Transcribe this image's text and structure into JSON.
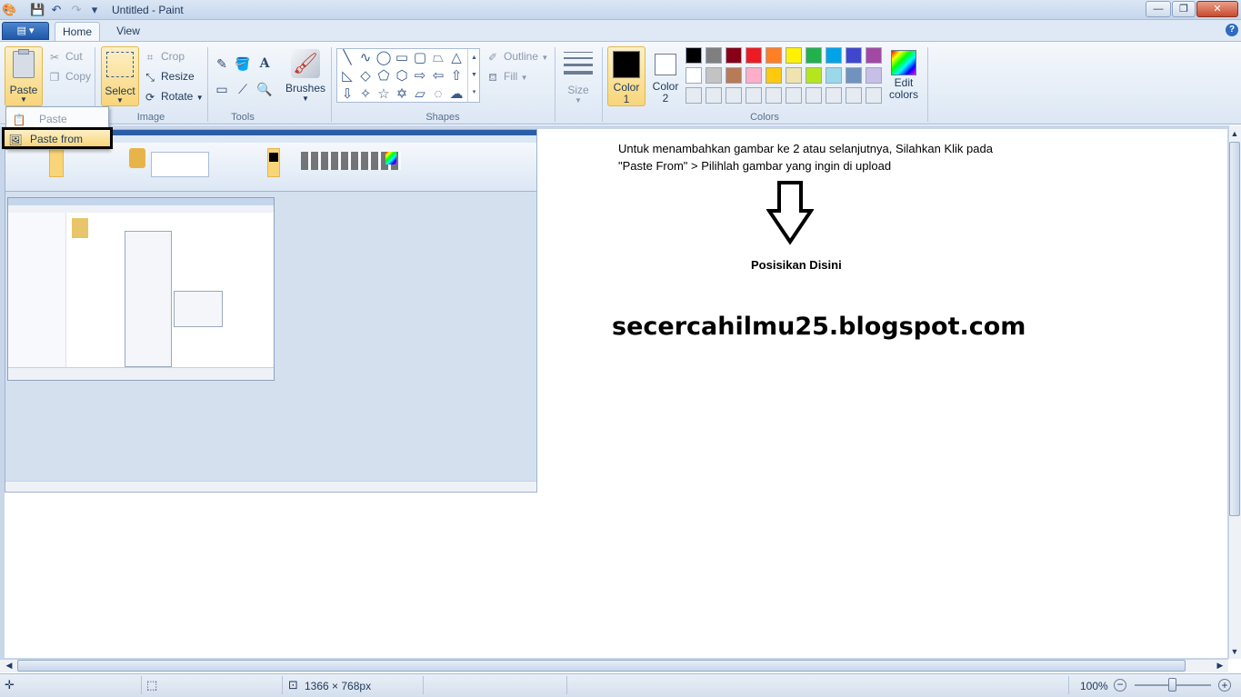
{
  "window": {
    "title": "Untitled - Paint",
    "minimize_glyph": "—",
    "maximize_glyph": "❐",
    "close_glyph": "✕"
  },
  "quick_access": {
    "save_glyph": "💾",
    "undo_glyph": "↶",
    "redo_glyph": "↷",
    "customize_glyph": "▾"
  },
  "tabs": {
    "app_menu_glyph": "▤ ▾",
    "home": "Home",
    "view": "View",
    "help_glyph": "?"
  },
  "clipboard": {
    "paste": "Paste",
    "cut": "Cut",
    "copy": "Copy"
  },
  "image_group": {
    "label": "Image",
    "select": "Select",
    "crop": "Crop",
    "resize": "Resize",
    "rotate": "Rotate"
  },
  "tools_group": {
    "label": "Tools",
    "brushes": "Brushes"
  },
  "shapes_group": {
    "label": "Shapes",
    "outline": "Outline",
    "fill": "Fill"
  },
  "size_group": {
    "size": "Size"
  },
  "colors_group": {
    "label": "Colors",
    "color1_line1": "Color",
    "color1_line2": "1",
    "color2_line1": "Color",
    "color2_line2": "2",
    "edit_line1": "Edit",
    "edit_line2": "colors",
    "color1_value": "#000000",
    "color2_value": "#ffffff",
    "palette_row1": [
      "#000000",
      "#7f7f7f",
      "#880015",
      "#ed1c24",
      "#ff7f27",
      "#fff200",
      "#22b14c",
      "#00a2e8",
      "#3f48cc",
      "#a349a4"
    ],
    "palette_row2": [
      "#ffffff",
      "#c3c3c3",
      "#b97a57",
      "#ffaec9",
      "#ffc90e",
      "#efe4b0",
      "#b5e61d",
      "#99d9ea",
      "#7092be",
      "#c8bfe7"
    ],
    "palette_row3": [
      "#e6ebf2",
      "#e6ebf2",
      "#e6ebf2",
      "#e6ebf2",
      "#e6ebf2",
      "#e6ebf2",
      "#e6ebf2",
      "#e6ebf2",
      "#e6ebf2",
      "#e6ebf2"
    ]
  },
  "paste_menu": {
    "paste": "Paste",
    "paste_from": "Paste from"
  },
  "canvas": {
    "instruction_line1": "Untuk menambahkan gambar ke 2 atau selanjutnya, Silahkan Klik pada",
    "instruction_line2": "\"Paste From\" > Pilihlah gambar yang ingin di upload",
    "position_label": "Posisikan Disini",
    "blog_url": "secercahilmu25.blogspot.com"
  },
  "status": {
    "canvas_size": "1366 × 768px",
    "zoom": "100%",
    "zoom_value_percent": 100
  }
}
